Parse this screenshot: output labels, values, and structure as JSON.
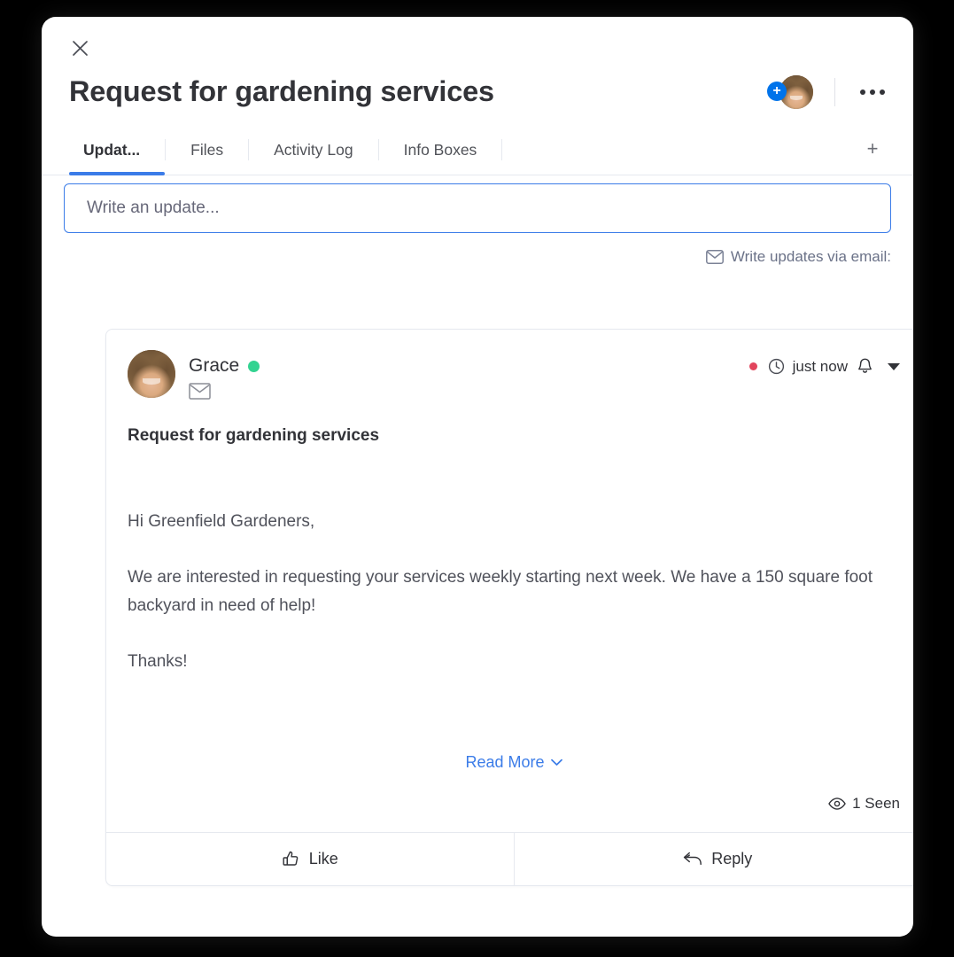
{
  "window": {
    "close_label": "close-icon"
  },
  "header": {
    "title": "Request for gardening services",
    "avatar_badge": "+",
    "more_menu": "more-options"
  },
  "tabs": {
    "items": [
      {
        "label": "Updat...",
        "active": true
      },
      {
        "label": "Files",
        "active": false
      },
      {
        "label": "Activity Log",
        "active": false
      },
      {
        "label": "Info Boxes",
        "active": false
      }
    ],
    "add_label": "+"
  },
  "composer": {
    "placeholder": "Write an update...",
    "value": "",
    "via_email_label": "Write updates via email:"
  },
  "post": {
    "author": "Grace",
    "status": "online",
    "timestamp": "just now",
    "title": "Request for gardening services",
    "paragraphs": [
      "Hi Greenfield Gardeners,",
      "We are interested in requesting your services weekly starting next week. We have a 150 square foot backyard in need of help!",
      "Thanks!"
    ],
    "read_more_label": "Read More",
    "seen_label": "1 Seen",
    "like_label": "Like",
    "reply_label": "Reply"
  },
  "colors": {
    "accent_blue": "#3b7ce8",
    "badge_blue": "#0073ea",
    "online_green": "#33d391",
    "unread_red": "#e2445c",
    "text_dark": "#323338",
    "text_muted": "#676879",
    "border": "#e6e9ef"
  }
}
